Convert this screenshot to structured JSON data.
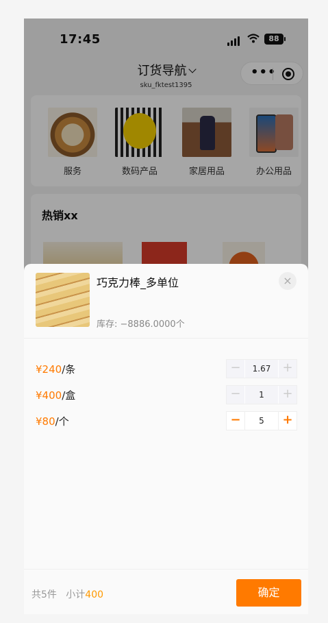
{
  "status_bar": {
    "time": "17:45",
    "battery": "88"
  },
  "nav": {
    "title": "订货导航",
    "subtitle": "sku_fktest1395"
  },
  "categories": [
    {
      "label": "服务"
    },
    {
      "label": "数码产品"
    },
    {
      "label": "家居用品"
    },
    {
      "label": "办公用品"
    }
  ],
  "hot_section": {
    "title": "热销xx"
  },
  "sheet": {
    "product_name": "巧克力棒_多单位",
    "stock": "库存: −8886.0000个",
    "close_icon": "×",
    "units": [
      {
        "price": "¥240",
        "unit": "/条",
        "qty": "1.67",
        "enabled": false
      },
      {
        "price": "¥400",
        "unit": "/盒",
        "qty": "1",
        "enabled": false
      },
      {
        "price": "¥80",
        "unit": "/个",
        "qty": "5",
        "enabled": true
      }
    ],
    "stepper_minus": "−",
    "stepper_plus": "+",
    "summary_count": "共5件",
    "summary_subtotal_label": "小计",
    "summary_subtotal_value": "400",
    "confirm_label": "确定"
  },
  "colors": {
    "accent": "#ff7a00",
    "overlay": "rgba(0,0,0,0.35)"
  }
}
